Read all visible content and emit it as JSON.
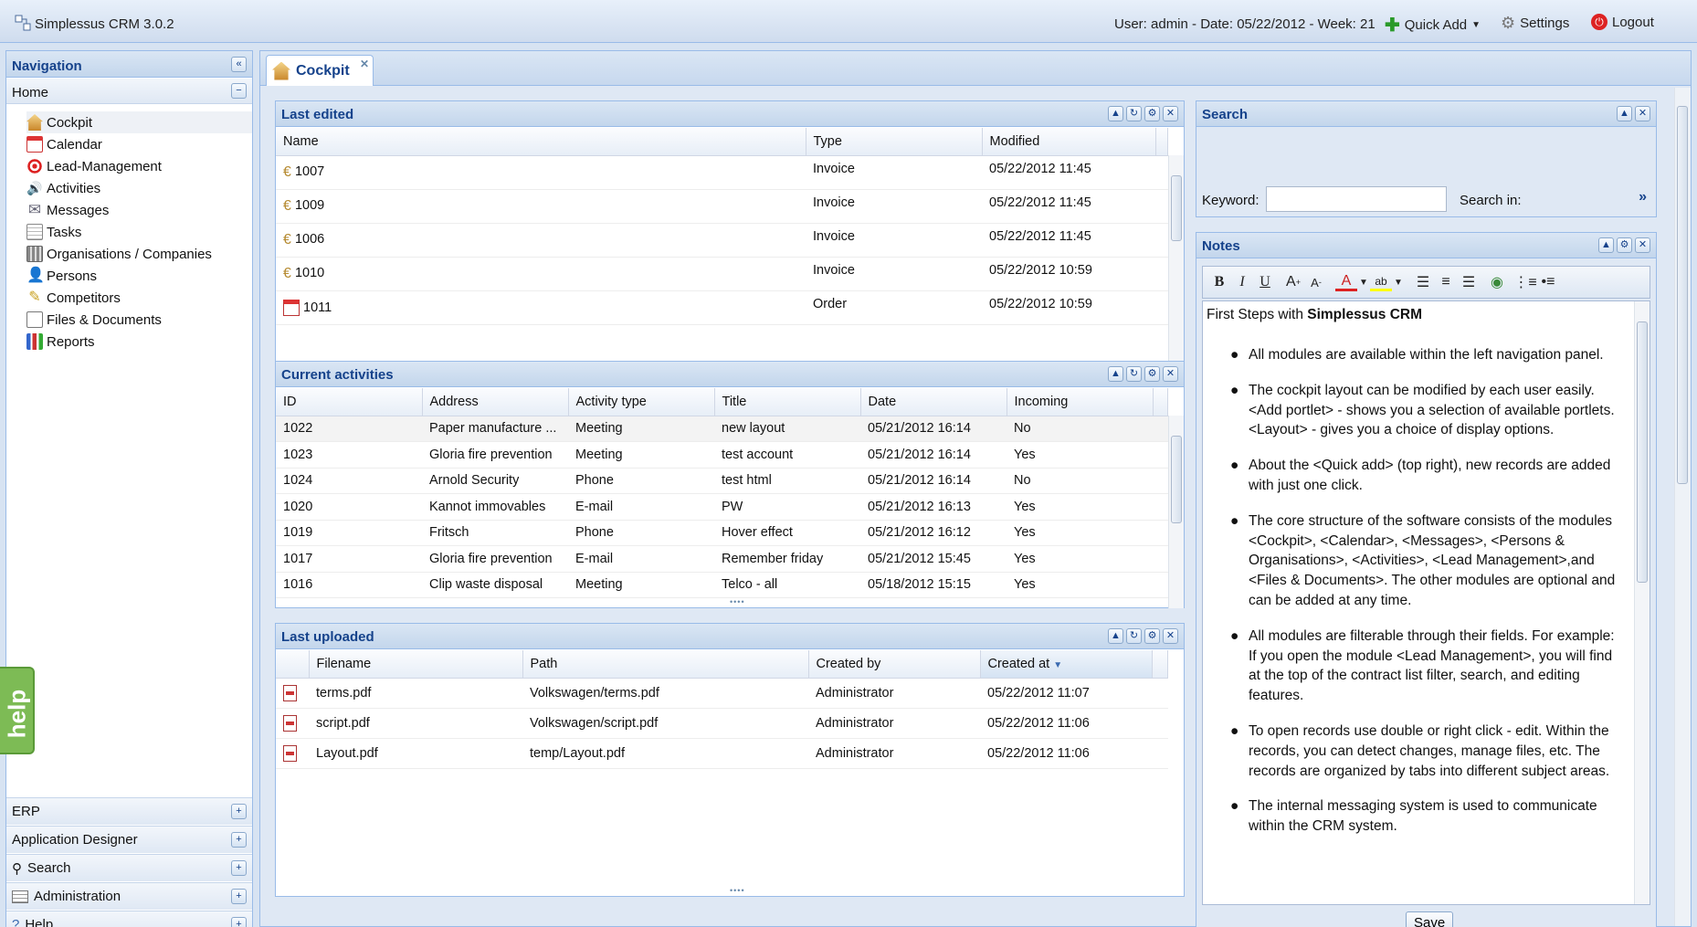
{
  "app": {
    "title": "Simplessus CRM 3.0.2",
    "user_info": "User: admin - Date: 05/22/2012 - Week: 21"
  },
  "topbar": {
    "quick_add": "Quick Add",
    "settings": "Settings",
    "logout": "Logout"
  },
  "nav": {
    "title": "Navigation",
    "home": "Home",
    "items": [
      {
        "label": "Cockpit",
        "icon": "house-icon"
      },
      {
        "label": "Calendar",
        "icon": "calendar-icon"
      },
      {
        "label": "Lead-Management",
        "icon": "target-icon"
      },
      {
        "label": "Activities",
        "icon": "speaker-icon"
      },
      {
        "label": "Messages",
        "icon": "envelope-icon"
      },
      {
        "label": "Tasks",
        "icon": "tasks-icon"
      },
      {
        "label": "Organisations / Companies",
        "icon": "building-icon"
      },
      {
        "label": "Persons",
        "icon": "person-icon"
      },
      {
        "label": "Competitors",
        "icon": "pencil-icon"
      },
      {
        "label": "Files & Documents",
        "icon": "folder-icon"
      },
      {
        "label": "Reports",
        "icon": "chart-icon"
      }
    ],
    "sections": [
      "ERP",
      "Application Designer",
      "Search",
      "Administration",
      "Help"
    ]
  },
  "help_tab": "help",
  "tabs": {
    "cockpit": "Cockpit"
  },
  "last_edited": {
    "title": "Last edited",
    "columns": [
      "Name",
      "Type",
      "Modified"
    ],
    "rows": [
      {
        "name": "1007",
        "type": "Invoice",
        "modified": "05/22/2012 11:45"
      },
      {
        "name": "1009",
        "type": "Invoice",
        "modified": "05/22/2012 11:45"
      },
      {
        "name": "1006",
        "type": "Invoice",
        "modified": "05/22/2012 11:45"
      },
      {
        "name": "1010",
        "type": "Invoice",
        "modified": "05/22/2012 10:59"
      },
      {
        "name": "1011",
        "type": "Order",
        "modified": "05/22/2012 10:59"
      }
    ]
  },
  "current_activities": {
    "title": "Current activities",
    "columns": [
      "ID",
      "Address",
      "Activity type",
      "Title",
      "Date",
      "Incoming"
    ],
    "rows": [
      {
        "id": "1022",
        "address": "Paper manufacture ...",
        "type": "Meeting",
        "title": "new layout",
        "date": "05/21/2012 16:14",
        "incoming": "No"
      },
      {
        "id": "1023",
        "address": "Gloria fire prevention",
        "type": "Meeting",
        "title": "test account",
        "date": "05/21/2012 16:14",
        "incoming": "Yes"
      },
      {
        "id": "1024",
        "address": "Arnold Security",
        "type": "Phone",
        "title": "test html",
        "date": "05/21/2012 16:14",
        "incoming": "No"
      },
      {
        "id": "1020",
        "address": "Kannot immovables",
        "type": "E-mail",
        "title": "PW",
        "date": "05/21/2012 16:13",
        "incoming": "Yes"
      },
      {
        "id": "1019",
        "address": "Fritsch",
        "type": "Phone",
        "title": "Hover effect",
        "date": "05/21/2012 16:12",
        "incoming": "Yes"
      },
      {
        "id": "1017",
        "address": "Gloria fire prevention",
        "type": "E-mail",
        "title": "Remember friday",
        "date": "05/21/2012 15:45",
        "incoming": "Yes"
      },
      {
        "id": "1016",
        "address": "Clip waste disposal",
        "type": "Meeting",
        "title": "Telco - all",
        "date": "05/18/2012 15:15",
        "incoming": "Yes"
      }
    ]
  },
  "last_uploaded": {
    "title": "Last uploaded",
    "columns": [
      "Filename",
      "Path",
      "Created by",
      "Created at"
    ],
    "rows": [
      {
        "filename": "terms.pdf",
        "path": "Volkswagen/terms.pdf",
        "by": "Administrator",
        "at": "05/22/2012 11:07"
      },
      {
        "filename": "script.pdf",
        "path": "Volkswagen/script.pdf",
        "by": "Administrator",
        "at": "05/22/2012 11:06"
      },
      {
        "filename": "Layout.pdf",
        "path": "temp/Layout.pdf",
        "by": "Administrator",
        "at": "05/22/2012 11:06"
      }
    ]
  },
  "search": {
    "title": "Search",
    "keyword_label": "Keyword:",
    "keyword_value": "",
    "search_in_label": "Search in:"
  },
  "notes": {
    "title": "Notes",
    "heading_prefix": "First Steps with ",
    "heading_bold": "Simplessus CRM",
    "bullets": [
      "All modules are available within the left navigation panel.",
      "The cockpit layout can be modified by each user easily. <Add portlet> - shows you a selection of available portlets. <Layout> - gives you a choice of display options.",
      "About the <Quick add> (top right), new records are added with just one click.",
      "The core structure of the software consists of the modules <Cockpit>, <Calendar>, <Messages>, <Persons & Organisations>, <Activities>, <Lead Management>,and <Files & Documents>. The other modules are optional and can be added at any time.",
      "All modules are filterable through their fields. For example: If you open the module <Lead Management>, you will find at the top of the contract list filter, search, and editing features.",
      "To open records use double or right click - edit. Within the records, you can detect changes, manage files, etc. The records are organized by tabs into different subject areas.",
      "The internal messaging system is used to communicate within the CRM system."
    ],
    "save": "Save"
  }
}
